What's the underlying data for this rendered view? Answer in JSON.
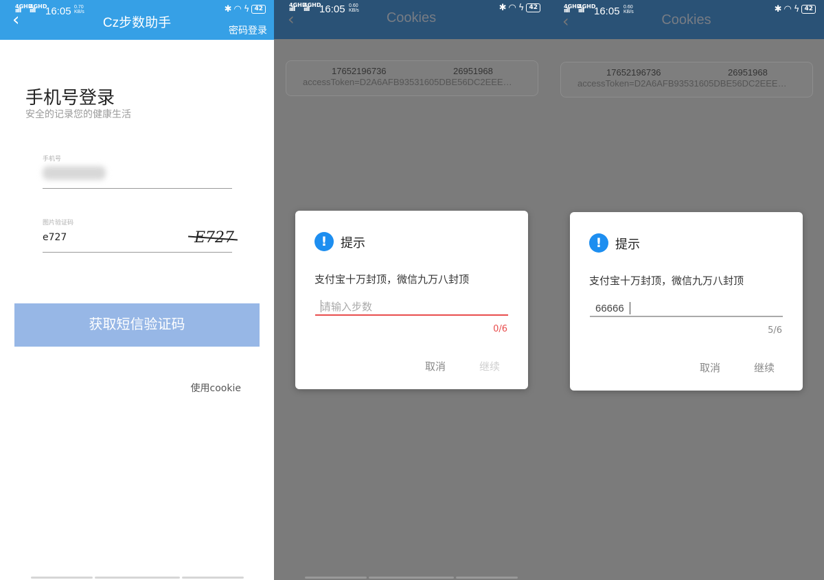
{
  "status_bar": {
    "network_left": "4GHD",
    "network_right": "4GHD",
    "signal_bars": "ııll",
    "time": "16:05",
    "speed_p1": "0.70",
    "speed_p2": "0.60",
    "speed_p3": "0.60",
    "speed_unit": "KB/s",
    "battery": "42"
  },
  "login": {
    "title": "Cz步数助手",
    "password_login": "密码登录",
    "heading": "手机号登录",
    "subheading": "安全的记录您的健康生活",
    "phone_label": "手机号",
    "captcha_label": "图片验证码",
    "captcha_value": "e727",
    "captcha_image_text": "E727",
    "sms_button": "获取短信验证码",
    "use_cookie": "使用cookie"
  },
  "cookies": {
    "title": "Cookies",
    "phone": "17652196736",
    "uid": "26951968",
    "token": "accessToken=D2A6AFB93531605DBE56DC2EEE…"
  },
  "dialog_empty": {
    "title": "提示",
    "message": "支付宝十万封顶，微信九万八封顶",
    "placeholder": "请输入步数",
    "value": "",
    "counter": "0/6",
    "cancel": "取消",
    "continue": "继续"
  },
  "dialog_filled": {
    "title": "提示",
    "message": "支付宝十万封顶，微信九万八封顶",
    "value": "66666",
    "counter": "5/6",
    "cancel": "取消",
    "continue": "继续"
  },
  "colors": {
    "header_blue": "#36a0e6",
    "button_blue": "#97b7e6",
    "dialog_icon": "#1d8ef0",
    "error_red": "#e84c4c",
    "dim_overlay": "#7b7b7b"
  },
  "icons": [
    "back-chevron-icon",
    "bluetooth-icon",
    "wifi-icon",
    "charging-icon",
    "battery-icon",
    "alert-icon"
  ]
}
